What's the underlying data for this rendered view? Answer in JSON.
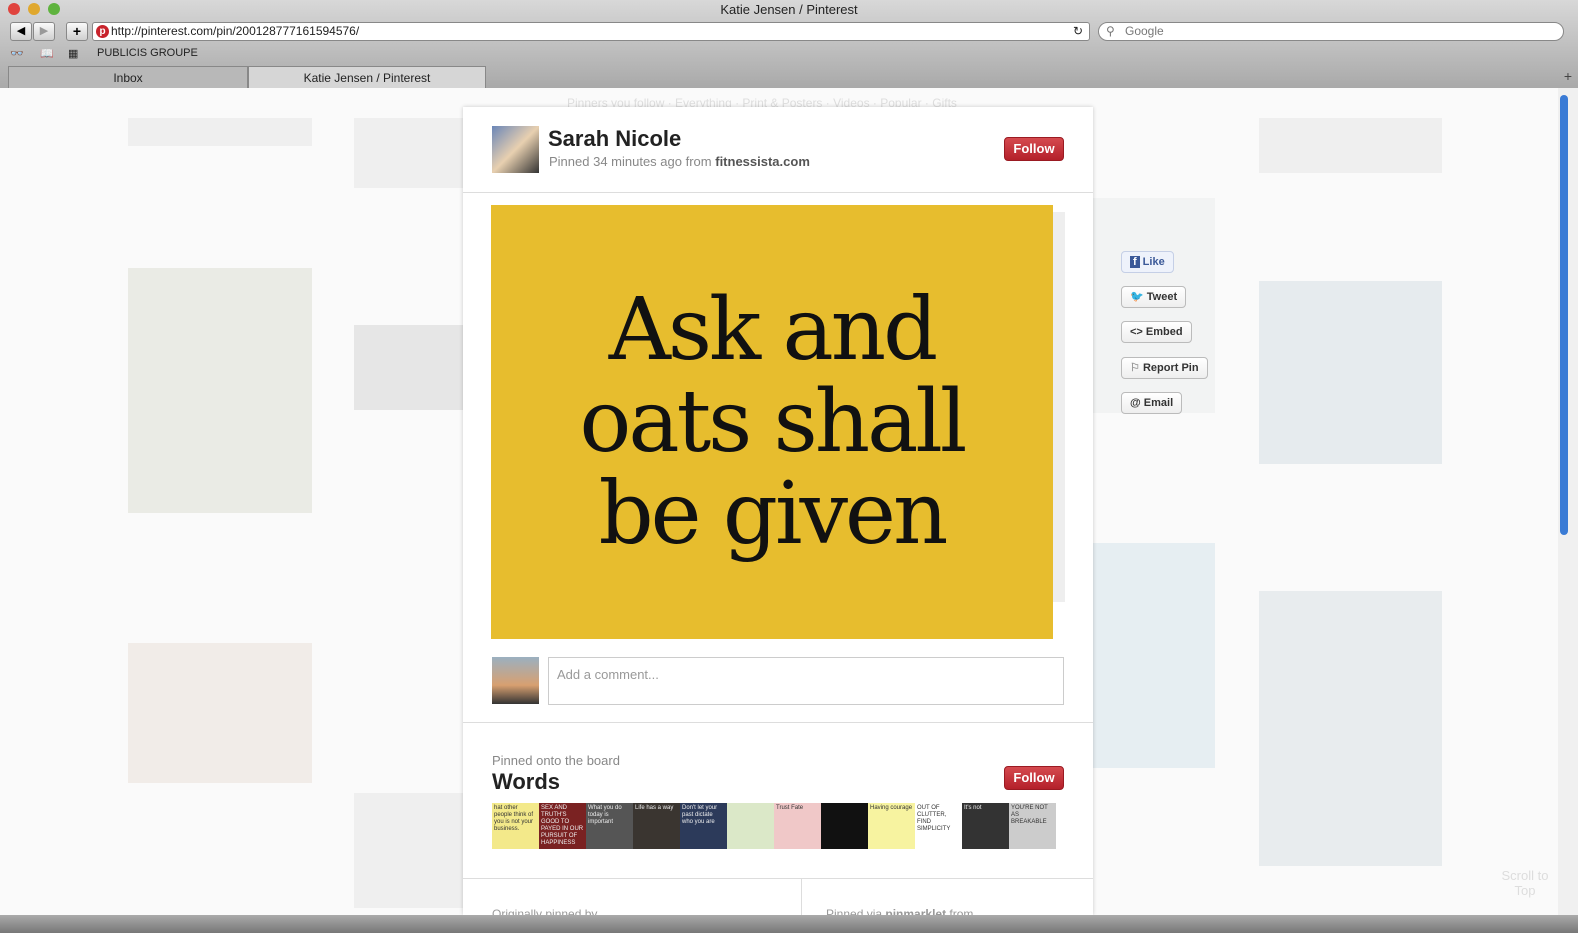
{
  "window": {
    "title": "Katie Jensen / Pinterest",
    "url": "http://pinterest.com/pin/200128777161594576/",
    "search_placeholder": "Google",
    "bookmark": "PUBLICIS GROUPE"
  },
  "tabs": [
    {
      "label": "Inbox"
    },
    {
      "label": "Katie Jensen / Pinterest"
    }
  ],
  "nav": "Pinners you follow · Everything · Print & Posters · Videos · Popular · Gifts",
  "pin": {
    "pinner": "Sarah Nicole",
    "pinned_prefix": "Pinned 34 minutes ago from",
    "source": "fitnessista.com",
    "follow": "Follow",
    "quote_lines": [
      "Ask and",
      "oats shall",
      "be given"
    ],
    "comment_placeholder": "Add a comment..."
  },
  "actions": {
    "like": "Like",
    "tweet": "Tweet",
    "embed": "<> Embed",
    "report": "Report Pin",
    "email": "@ Email"
  },
  "board": {
    "intro": "Pinned onto the board",
    "name": "Words",
    "follow": "Follow",
    "thumbs": [
      {
        "text": "hat other people think of you is not your business.",
        "bg": "#f3e98a"
      },
      {
        "text": "SEX AND TRUTH'S GOOD TO PAYED IN OUR PURSUIT OF HAPPINESS",
        "bg": "#7a2222"
      },
      {
        "text": "What you do today is important",
        "bg": "#555"
      },
      {
        "text": "Life has a way",
        "bg": "#3a3530"
      },
      {
        "text": "Don't let your past dictate who you are",
        "bg": "#2c3a5a"
      },
      {
        "text": "",
        "bg": "#dbe8c8"
      },
      {
        "text": "Trust Fate",
        "bg": "#f0c8c8"
      },
      {
        "text": "",
        "bg": "#111"
      },
      {
        "text": "Having courage",
        "bg": "#f7f3a0"
      },
      {
        "text": "OUT OF CLUTTER, FIND SIMPLICITY",
        "bg": "#fff"
      },
      {
        "text": "It's not",
        "bg": "#333"
      },
      {
        "text": "YOU'RE NOT AS BREAKABLE",
        "bg": "#ccc"
      }
    ]
  },
  "footer": {
    "left": "Originally pinned by",
    "right_prefix": "Pinned via",
    "right_source": "pinmarklet",
    "right_suffix": "from"
  },
  "scroll_top": "Scroll to Top"
}
